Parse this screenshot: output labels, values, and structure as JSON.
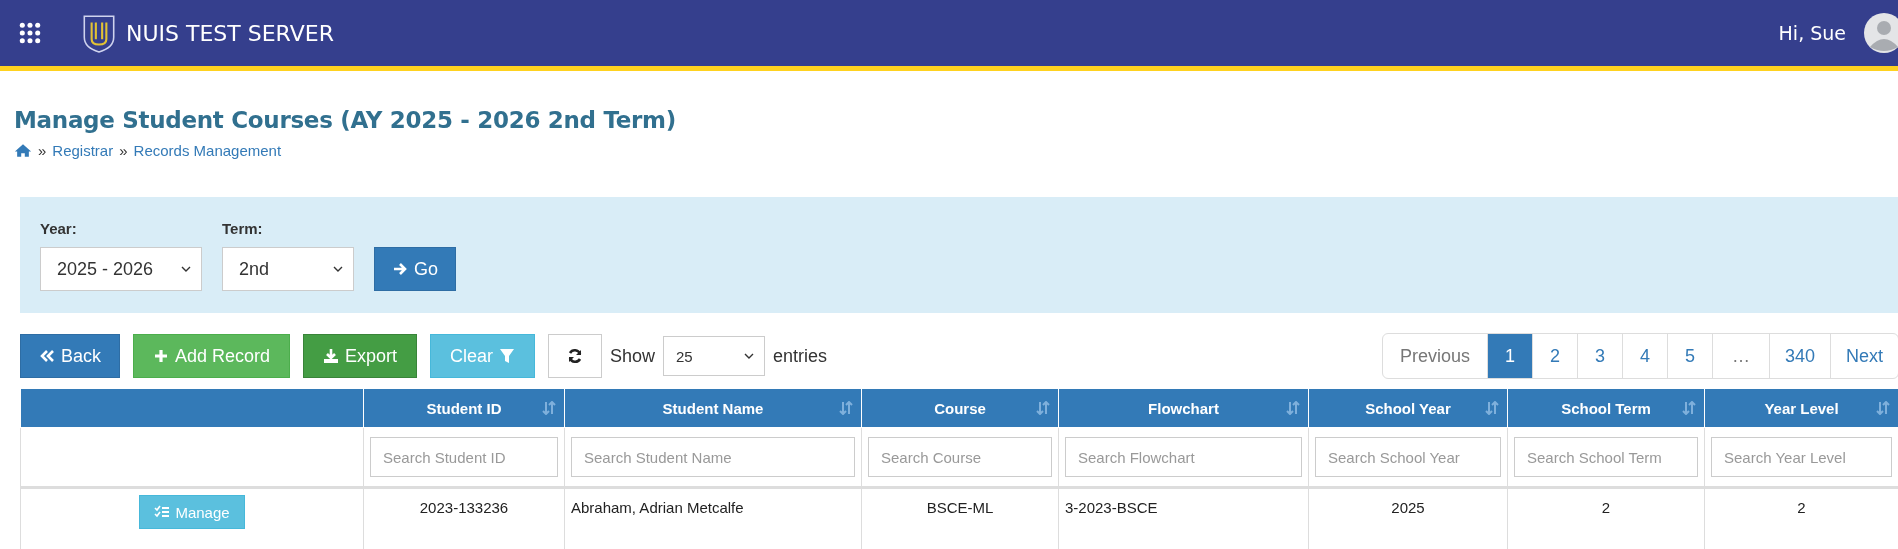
{
  "header": {
    "title": "NUIS TEST SERVER",
    "greeting": "Hi, Sue"
  },
  "page": {
    "title": "Manage Student Courses (AY 2025 - 2026 2nd Term)",
    "breadcrumb": [
      {
        "separator": "»",
        "label": "Registrar"
      },
      {
        "separator": "»",
        "label": "Records Management"
      }
    ]
  },
  "filters": [
    {
      "label": "Year:",
      "value": "2025 - 2026"
    },
    {
      "label": "Term:",
      "value": "2nd"
    }
  ],
  "go_button": "Go",
  "toolbar": [
    {
      "kind": "back",
      "label": "Back"
    },
    {
      "kind": "add",
      "label": "Add Record"
    },
    {
      "kind": "export",
      "label": "Export"
    },
    {
      "kind": "clear",
      "label": "Clear"
    },
    {
      "kind": "refresh"
    }
  ],
  "entries": {
    "before": "Show",
    "value": "25",
    "after": "entries"
  },
  "pagination": [
    {
      "label": "Previous",
      "kind": "nav",
      "selected": false
    },
    {
      "label": "1",
      "kind": "page",
      "selected": true
    },
    {
      "label": "2",
      "kind": "page",
      "selected": false
    },
    {
      "label": "3",
      "kind": "page",
      "selected": false
    },
    {
      "label": "4",
      "kind": "page",
      "selected": false
    },
    {
      "label": "5",
      "kind": "page",
      "selected": false
    },
    {
      "label": "…",
      "kind": "gap",
      "selected": false
    },
    {
      "label": "340",
      "kind": "page",
      "selected": false
    },
    {
      "label": "Next",
      "kind": "nav",
      "selected": false
    }
  ],
  "table": {
    "columns": [
      {
        "kind": "action"
      },
      {
        "kind": "text",
        "label": "Student ID",
        "placeholder": "Search Student ID"
      },
      {
        "kind": "text",
        "label": "Student Name",
        "placeholder": "Search Student Name"
      },
      {
        "kind": "text",
        "label": "Course",
        "placeholder": "Search Course"
      },
      {
        "kind": "text",
        "label": "Flowchart",
        "placeholder": "Search Flowchart"
      },
      {
        "kind": "text",
        "label": "School Year",
        "placeholder": "Search School Year"
      },
      {
        "kind": "text",
        "label": "School Term",
        "placeholder": "Search School Term"
      },
      {
        "kind": "text",
        "label": "Year Level",
        "placeholder": "Search Year Level"
      }
    ],
    "rows": [
      {
        "cells": [
          "Manage",
          "2023-133236",
          "Abraham, Adrian Metcalfe",
          "BSCE-ML",
          "3-2023-BSCE",
          "2025",
          "2",
          "2"
        ]
      }
    ]
  }
}
